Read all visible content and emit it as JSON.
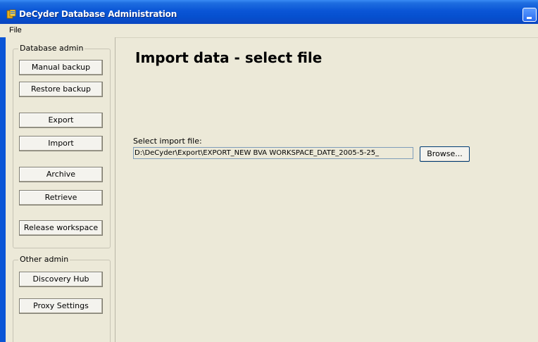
{
  "window": {
    "title": "DeCyder Database Administration",
    "accent": "#0a55d6"
  },
  "menubar": {
    "items": [
      "File"
    ]
  },
  "sidebar": {
    "database_admin": {
      "label": "Database admin",
      "buttons": [
        "Manual backup",
        "Restore backup",
        "Export",
        "Import",
        "Archive",
        "Retrieve",
        "Release workspace"
      ]
    },
    "other_admin": {
      "label": "Other admin",
      "buttons": [
        "Discovery Hub",
        "Proxy Settings"
      ]
    }
  },
  "main": {
    "page_title": "Import data - select file",
    "file_label": "Select import file:",
    "file_path": "D:\\DeCyder\\Export\\EXPORT_NEW BVA WORKSPACE_DATE_2005-5-25_",
    "browse_label": "Browse..."
  }
}
